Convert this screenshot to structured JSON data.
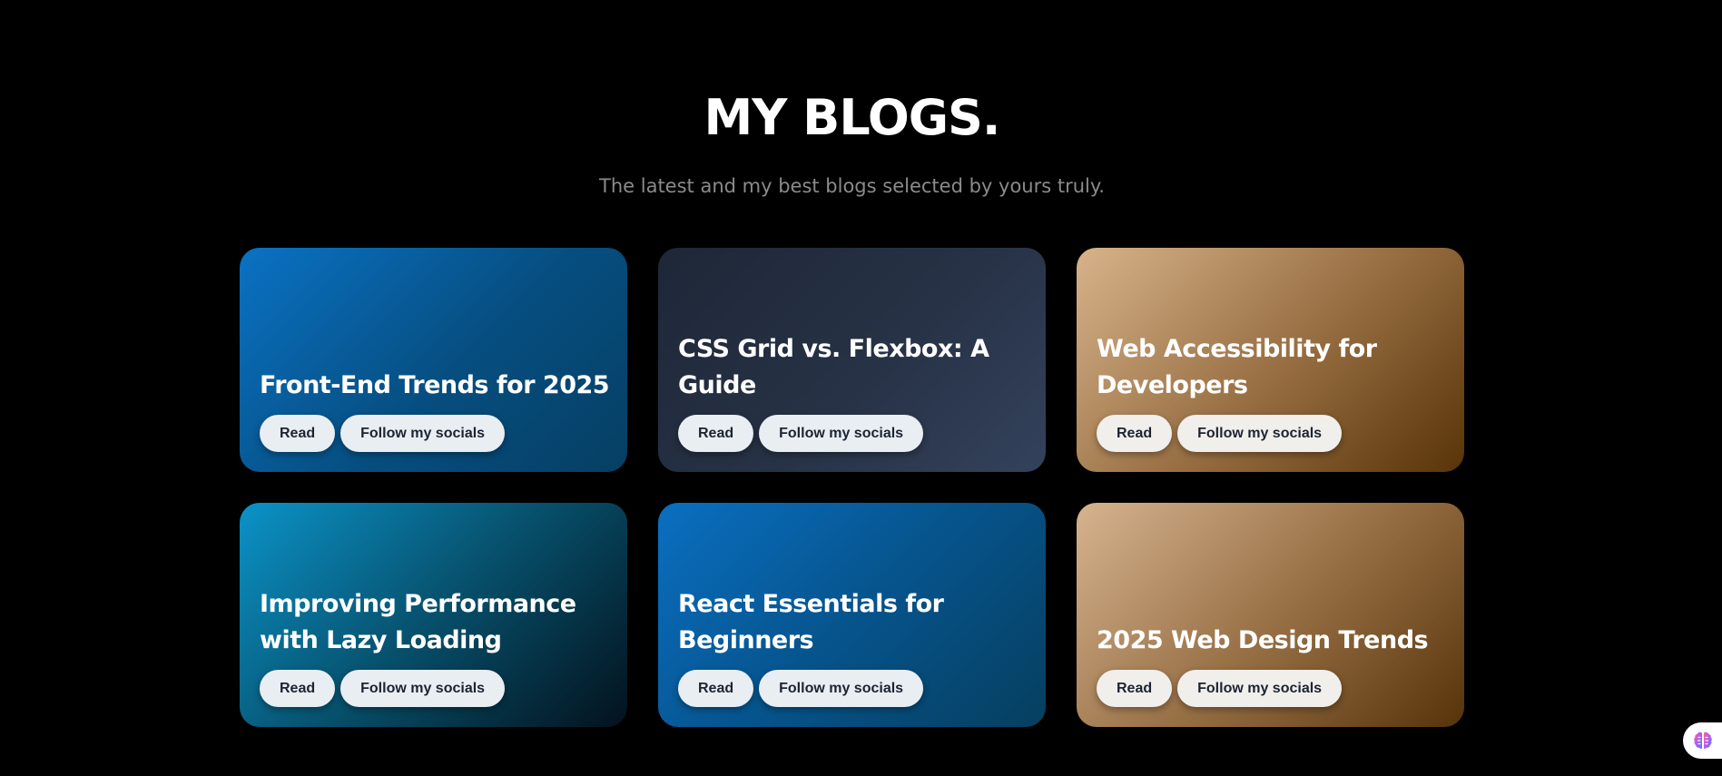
{
  "header": {
    "title": "MY BLOGS.",
    "subtitle": "The latest and my best blogs selected by yours truly."
  },
  "cards": [
    {
      "title": "Front-End Trends for 2025",
      "read_label": "Read",
      "socials_label": "Follow my socials"
    },
    {
      "title": "CSS Grid vs. Flexbox: A Guide",
      "read_label": "Read",
      "socials_label": "Follow my socials"
    },
    {
      "title": "Web Accessibility for Developers",
      "read_label": "Read",
      "socials_label": "Follow my socials"
    },
    {
      "title": "Improving Performance with Lazy Loading",
      "read_label": "Read",
      "socials_label": "Follow my socials"
    },
    {
      "title": "React Essentials for Beginners",
      "read_label": "Read",
      "socials_label": "Follow my socials"
    },
    {
      "title": "2025 Web Design Trends",
      "read_label": "Read",
      "socials_label": "Follow my socials"
    }
  ],
  "colors": {
    "background": "#000000",
    "heading": "#ffffff",
    "subheading": "#8b8b8b",
    "button_bg": "#eaeef1",
    "button_text": "#1c2433"
  },
  "icons": {
    "assistant_widget": "brain-icon"
  }
}
